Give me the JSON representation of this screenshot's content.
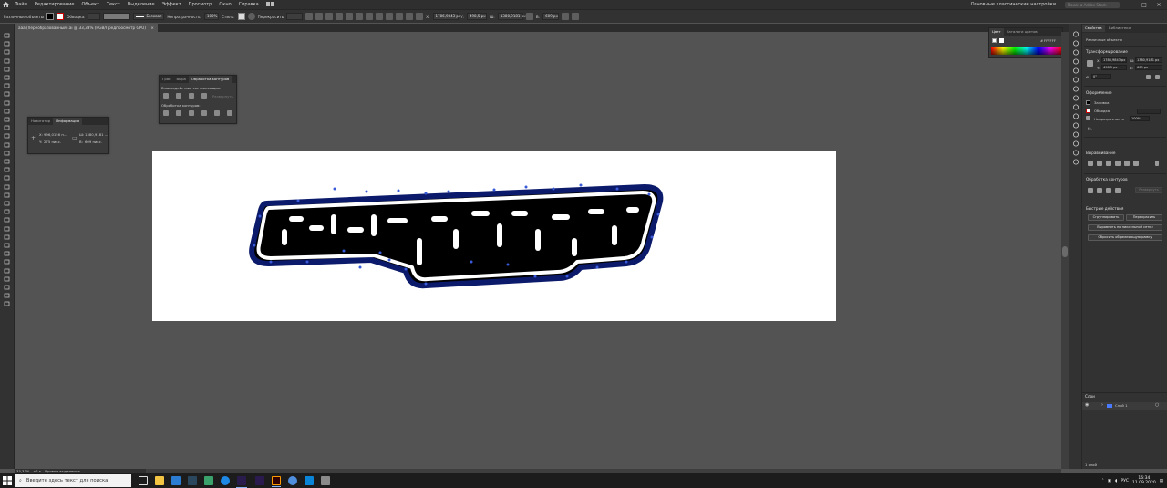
{
  "menubar": {
    "items": [
      "Файл",
      "Редактирование",
      "Объект",
      "Текст",
      "Выделение",
      "Эффект",
      "Просмотр",
      "Окно",
      "Справка"
    ],
    "workspace": "Основные классические настройки",
    "search_placeholder": "Поиск в Adobe Stock"
  },
  "controlbar": {
    "selection_label": "Различные объекты",
    "stroke_label": "Обводка:",
    "stroke_style": "Базовая",
    "opacity_label": "Непрозрачность:",
    "opacity_value": "100%",
    "style_label": "Стиль:",
    "recolor_label": "Перекрасить",
    "x_label": "X:",
    "x_value": "1786,9843 px",
    "y_label": "Y:",
    "y_value": "498,5 px",
    "w_label": "Ш:",
    "w_value": "1380,9181 px",
    "h_label": "В:",
    "h_value": "609 px"
  },
  "document": {
    "tab_title": "ааа (переобразованный).ai @ 33,33% (RGB/Предпросмотр GPU)"
  },
  "navigator_panel": {
    "tabs": [
      "Навигатор",
      "Информация"
    ],
    "x_label": "X:",
    "x_value": "996,0156 п...",
    "y_label": "Y:",
    "y_value": "275 пикс.",
    "w_label": "Ш:",
    "w_value": "1380,9181 ...",
    "h_label": "В:",
    "h_value": "609 пикс."
  },
  "pathfinder_panel": {
    "tabs": [
      "Гран",
      "Выра",
      "Обработка контуров"
    ],
    "shape_modes_label": "Взаимодействие составляющих:",
    "expand_label": "Развернуть",
    "pathfinders_label": "Обработка контуров:"
  },
  "color_panel": {
    "tabs": [
      "Цвет",
      "Каталоги цветов"
    ],
    "hex": "FFFFFF"
  },
  "properties_panel": {
    "tabs": [
      "Свойства",
      "Библиотеки"
    ],
    "selection_title": "Различные объекты",
    "transform_title": "Трансформирование",
    "x_value": "1786,9843 px",
    "y_value": "498,5 px",
    "w_value": "1380,9181 px",
    "h_value": "609 px",
    "angle_value": "0°",
    "appearance_title": "Оформление",
    "fill_label": "Заливка",
    "stroke_label": "Обводка",
    "opacity_label": "Непрозрачность",
    "opacity_value": "100%",
    "fx_label": "fx.",
    "align_title": "Выравнивание",
    "pathfinder_title": "Обработка контуров",
    "expand_label": "Развернуть",
    "quick_actions_title": "Быстрые действия",
    "group_button": "Сгруппировать",
    "recolor_button": "Перекрасить",
    "align_pixel_button": "Выровнять по пиксельной сетке",
    "reset_bbox_button": "Сбросить обрамляющую рамку"
  },
  "layers_panel": {
    "title": "Слои",
    "layer_name": "Слой 1",
    "layer_count": "1 слой"
  },
  "statusbar": {
    "zoom": "33,33%",
    "tool": "Прямое выделение"
  },
  "taskbar": {
    "search_placeholder": "Введите здесь текст для поиска",
    "language": "РУС",
    "time": "16:34",
    "date": "11.09.2020"
  },
  "colors": {
    "app_bg": "#535353",
    "panel_bg": "#323232",
    "selection_blue": "#3a5bd9",
    "artwork_fill": "#000000",
    "artwork_outline": "#0b1a6a"
  }
}
